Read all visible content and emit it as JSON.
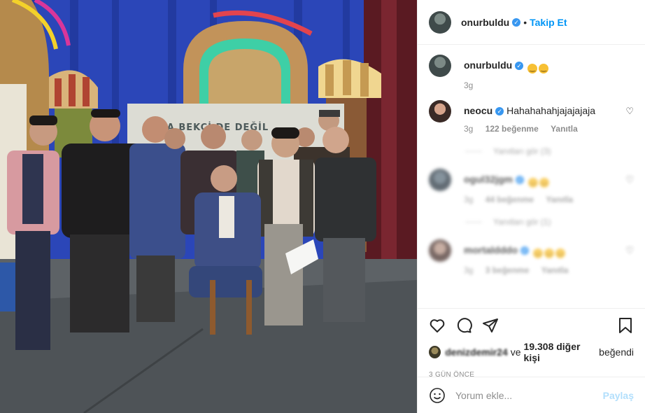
{
  "photo": {
    "sign_text": "DAHA BEKÇİ DE DEĞİL"
  },
  "header": {
    "username": "onurbuldu",
    "separator": "•",
    "follow_label": "Takip Et"
  },
  "caption": {
    "username": "onurbuldu",
    "emojis": [
      "😊",
      "😊"
    ],
    "time": "3g"
  },
  "comments": [
    {
      "username": "neocu",
      "text": "Hahahahahjajajajaja",
      "time": "3g",
      "likes": "122 beğenme",
      "reply_label": "Yanıtla",
      "replies_label": "Yanıtları gör (3)"
    },
    {
      "username": "ogul32jgm",
      "emojis": [
        "😄",
        "😄"
      ],
      "time": "3g",
      "likes": "44 beğenme",
      "reply_label": "Yanıtla",
      "replies_label": "Yanıtları gör (1)"
    },
    {
      "username": "mortaldddo",
      "emojis": [
        "😂",
        "😂",
        "😂"
      ],
      "time": "3g",
      "likes": "3 beğenme",
      "reply_label": "Yanıtla"
    }
  ],
  "likes": {
    "first_user": "denizdemir24",
    "conjunction": "ve",
    "count_text": "19.308 diğer kişi",
    "suffix": "beğendi"
  },
  "date_label": "3 GÜN ÖNCE",
  "comment_box": {
    "placeholder": "Yorum ekle...",
    "post_label": "Paylaş"
  },
  "colors": {
    "accent": "#0095f6",
    "verified": "#3897f0",
    "muted": "#8e8e8e"
  }
}
